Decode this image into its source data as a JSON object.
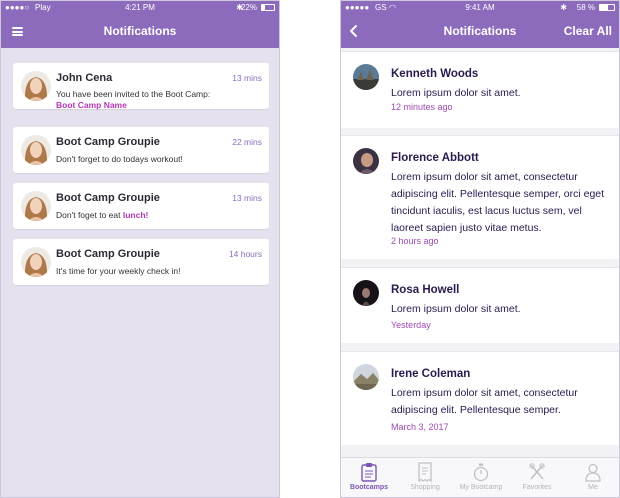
{
  "left": {
    "status": {
      "carrier": "Play",
      "time": "4:21 PM",
      "battery": "22%"
    },
    "title": "Notifications",
    "notifications": [
      {
        "name": "John Cena",
        "time": "13 mins",
        "message": "You have been invited to the Boot Camp:",
        "highlight": "Boot Camp Name"
      },
      {
        "name": "Boot Camp Groupie",
        "time": "22 mins",
        "message": "Don't forget to do todays workout!"
      },
      {
        "name": "Boot Camp Groupie",
        "time": "13 mins",
        "message": "Don't foget to eat ",
        "highlight": "lunch!"
      },
      {
        "name": "Boot Camp Groupie",
        "time": "14 hours",
        "message": "It's time for your weekly check in!"
      }
    ]
  },
  "right": {
    "status": {
      "carrier": "GS",
      "time": "9:41 AM",
      "battery": "58 %"
    },
    "title": "Notifications",
    "clear_all": "Clear All",
    "items": [
      {
        "name": "Kenneth Woods",
        "message": "Lorem ipsum dolor sit amet.",
        "time": "12 minutes ago"
      },
      {
        "name": "Florence Abbott",
        "message": "Lorem ipsum dolor sit amet, consectetur adipiscing elit. Pellentesque semper, orci eget tincidunt iaculis, est lacus luctus sem, vel laoreet sapien justo vitae metus.",
        "time": "2 hours ago"
      },
      {
        "name": "Rosa Howell",
        "message": "Lorem ipsum dolor sit amet.",
        "time": "Yesterday"
      },
      {
        "name": "Irene Coleman",
        "message": "Lorem ipsum dolor sit amet, consectetur adipiscing elit. Pellentesque semper.",
        "time": "March 3, 2017"
      }
    ],
    "tabs": [
      {
        "label": "Bootcamps",
        "icon": "clipboard-icon",
        "active": true
      },
      {
        "label": "Shopping",
        "icon": "receipt-icon"
      },
      {
        "label": "My Bootcamp",
        "icon": "stopwatch-icon"
      },
      {
        "label": "Favorites",
        "icon": "utensils-icon"
      },
      {
        "label": "Me",
        "icon": "user-icon"
      }
    ]
  },
  "colors": {
    "accent": "#8c6bbd",
    "highlight": "#b637b6",
    "time": "#a04ab5"
  }
}
